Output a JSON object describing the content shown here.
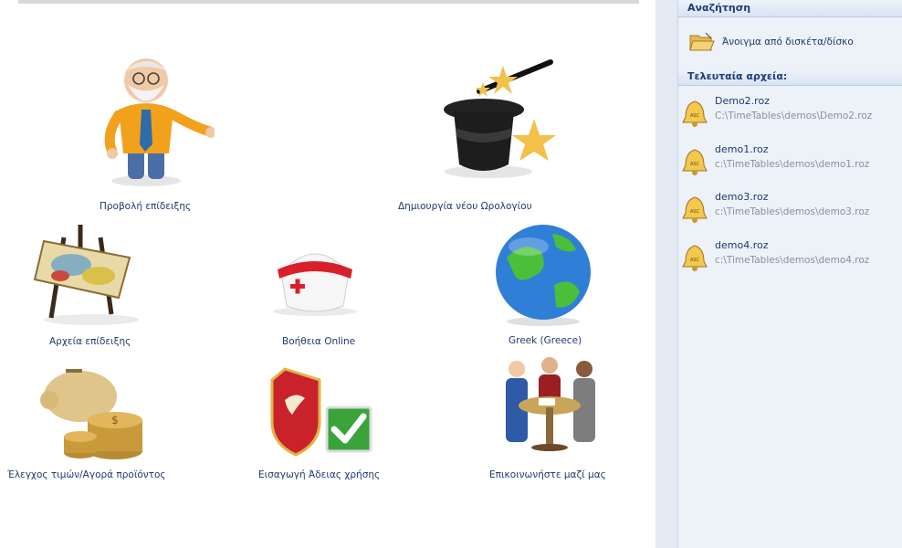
{
  "tiles": [
    {
      "label": "Προβολή επίδειξης"
    },
    {
      "label": "Δημιουργία νέου Ωρολογίου"
    },
    {
      "label": "Αρχεία επίδειξης"
    },
    {
      "label": "Βοήθεια Online"
    },
    {
      "label": "Greek (Greece)"
    },
    {
      "label": "Έλεγχος τιμών/Αγορά προϊόντος"
    },
    {
      "label": "Εισαγωγή Άδειας χρήσης"
    },
    {
      "label": "Επικοινωνήστε μαζί μας"
    }
  ],
  "panel": {
    "search_header": "Αναζήτηση",
    "open_label": "Άνοιγμα από δισκέτα/δίσκο",
    "recent_header": "Τελευταία αρχεία:",
    "recent_files": [
      {
        "name": "Demo2.roz",
        "path": "C:\\TimeTables\\demos\\Demo2.roz"
      },
      {
        "name": "demo1.roz",
        "path": "c:\\TimeTables\\demos\\demo1.roz"
      },
      {
        "name": "demo3.roz",
        "path": "c:\\TimeTables\\demos\\demo3.roz"
      },
      {
        "name": "demo4.roz",
        "path": "c:\\TimeTables\\demos\\demo4.roz"
      }
    ]
  }
}
